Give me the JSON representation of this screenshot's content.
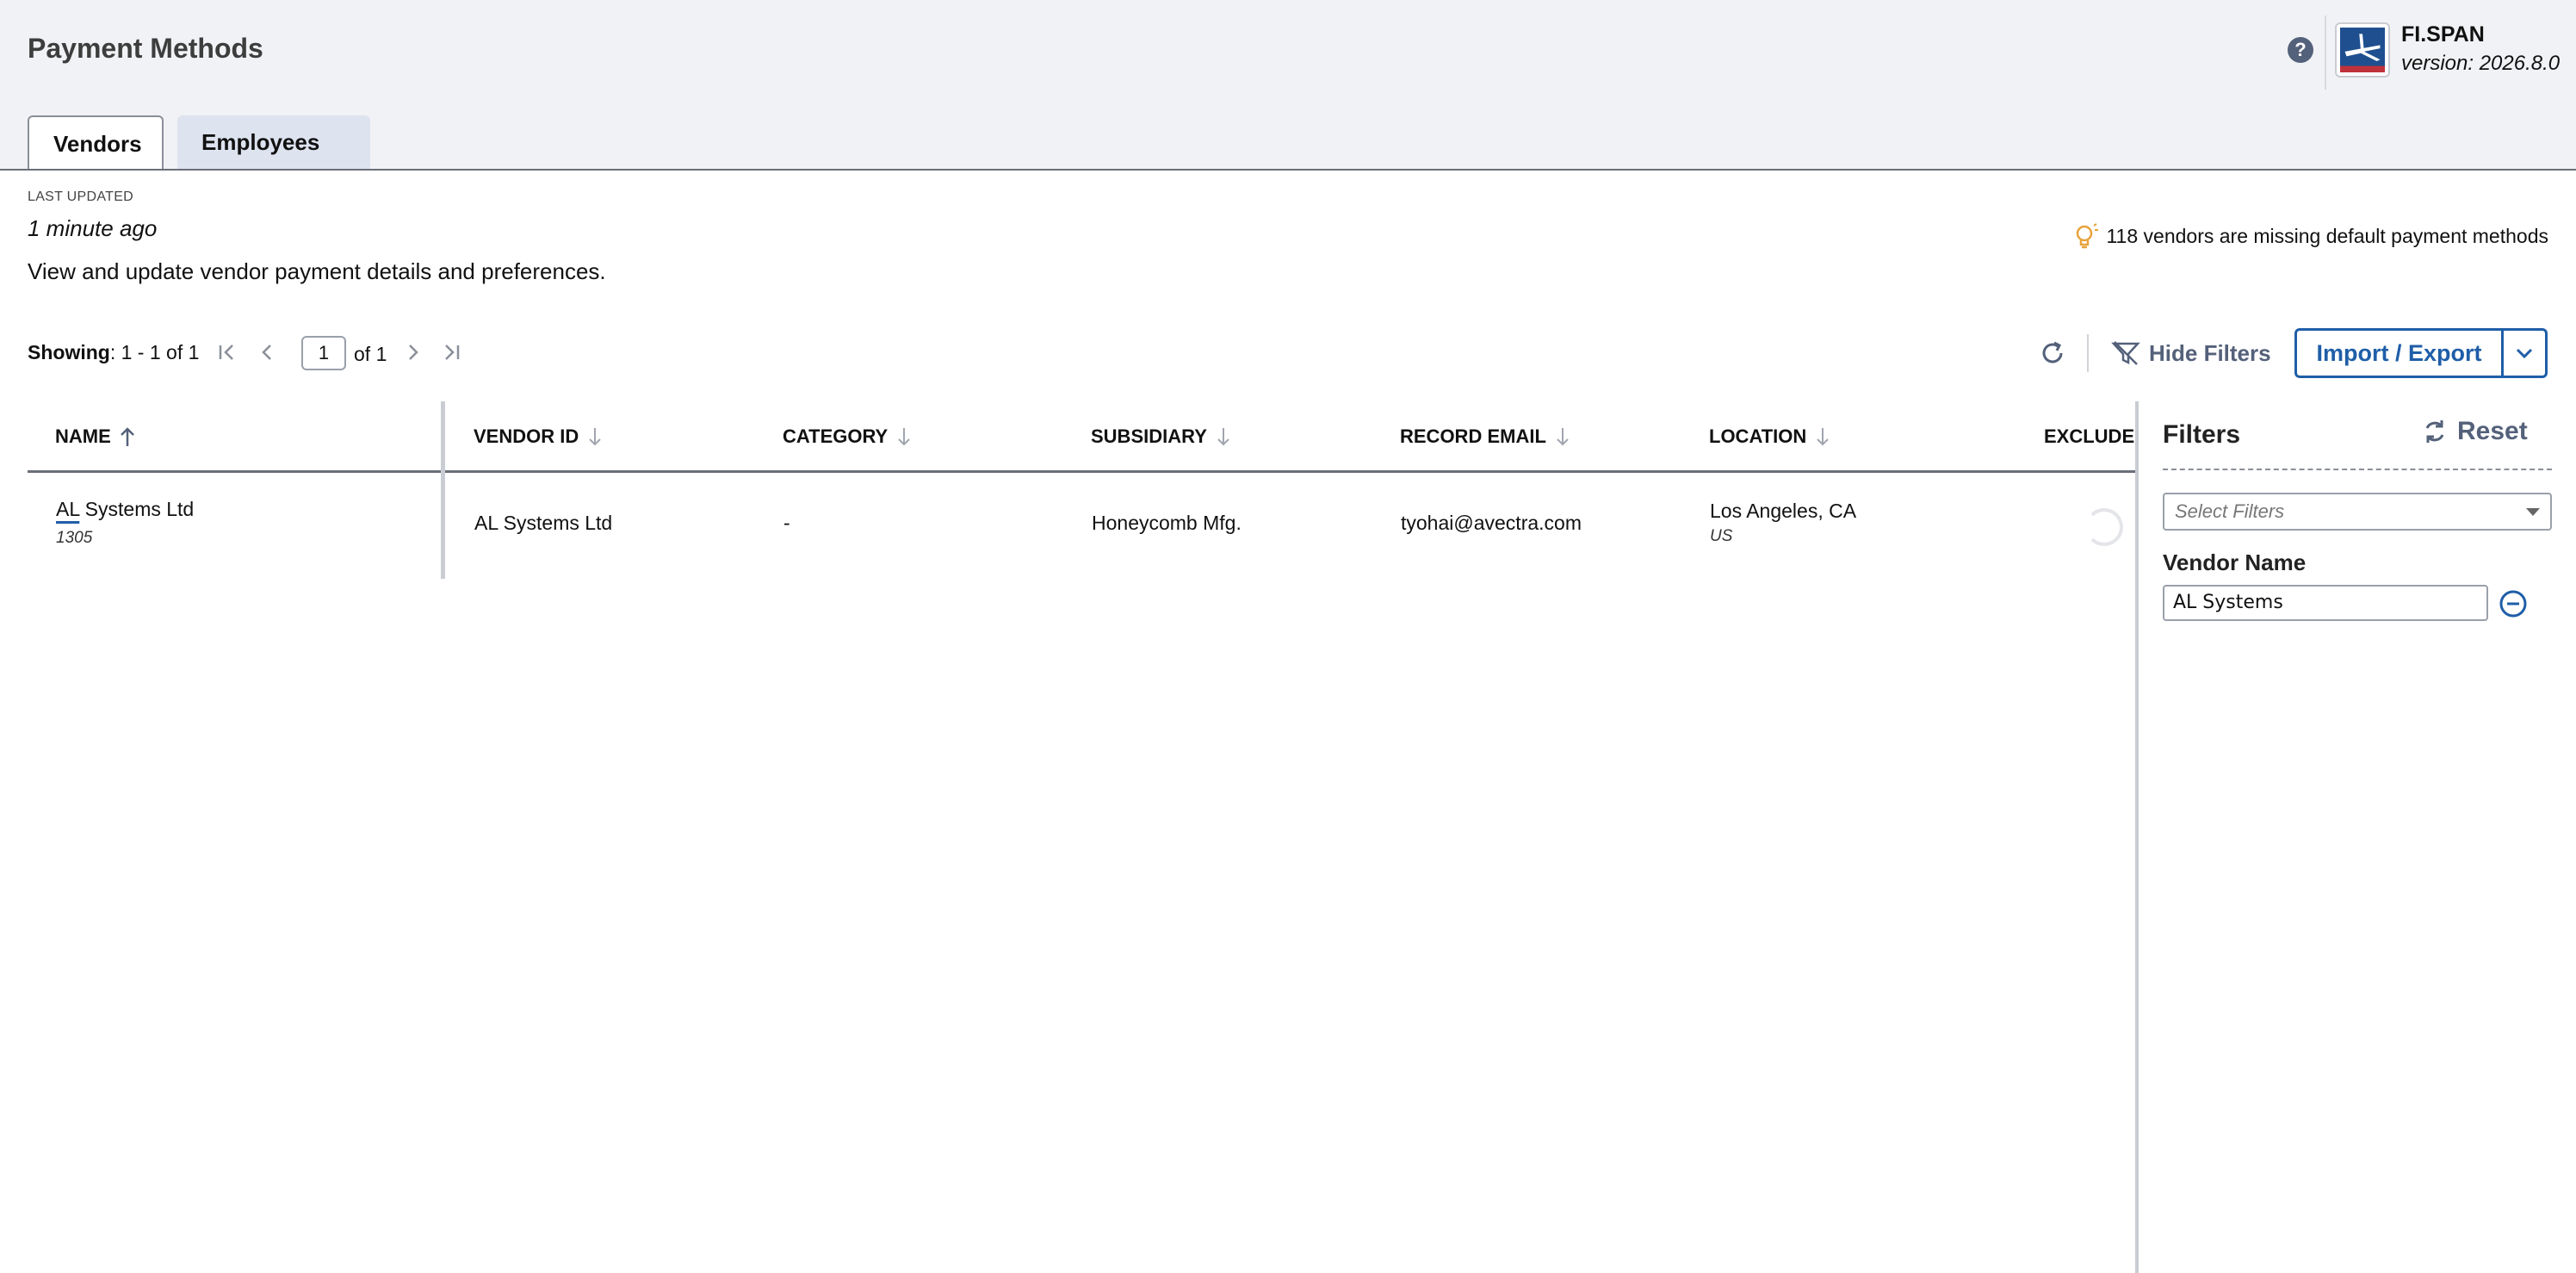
{
  "header": {
    "title": "Payment Methods",
    "brand_name": "FI.SPAN",
    "version": "version: 2026.8.0",
    "help_label": "?"
  },
  "tabs": [
    {
      "label": "Vendors",
      "active": true
    },
    {
      "label": "Employees",
      "active": false
    }
  ],
  "info": {
    "last_updated_label": "LAST UPDATED",
    "last_updated_value": "1 minute ago",
    "description": "View and update vendor payment details and preferences.",
    "missing_notice": "118 vendors are missing default payment methods"
  },
  "pagination": {
    "showing_label": "Showing",
    "showing_range": ": 1 - 1 of 1",
    "current_page": "1",
    "of_pages": "of 1"
  },
  "toolbar": {
    "hide_filters_label": "Hide Filters",
    "import_export_label": "Import / Export"
  },
  "table": {
    "columns": [
      "NAME",
      "VENDOR ID",
      "CATEGORY",
      "SUBSIDIARY",
      "RECORD EMAIL",
      "LOCATION",
      "EXCLUDE"
    ],
    "rows": [
      {
        "name_highlight": "AL",
        "name_rest": " Systems Ltd",
        "name_sub": "1305",
        "vendor_id": "AL Systems Ltd",
        "category": "-",
        "subsidiary": "Honeycomb Mfg.",
        "record_email": "tyohai@avectra.com",
        "location": "Los Angeles, CA",
        "location_sub": "US"
      }
    ]
  },
  "filters": {
    "title": "Filters",
    "reset_label": "Reset",
    "select_placeholder": "Select Filters",
    "vendor_name_label": "Vendor Name",
    "vendor_name_value": "AL Systems"
  },
  "colors": {
    "accent": "#1f5ea8",
    "muted": "#54617a",
    "header_bg": "#f1f2f5",
    "bulb": "#e7a33b"
  }
}
